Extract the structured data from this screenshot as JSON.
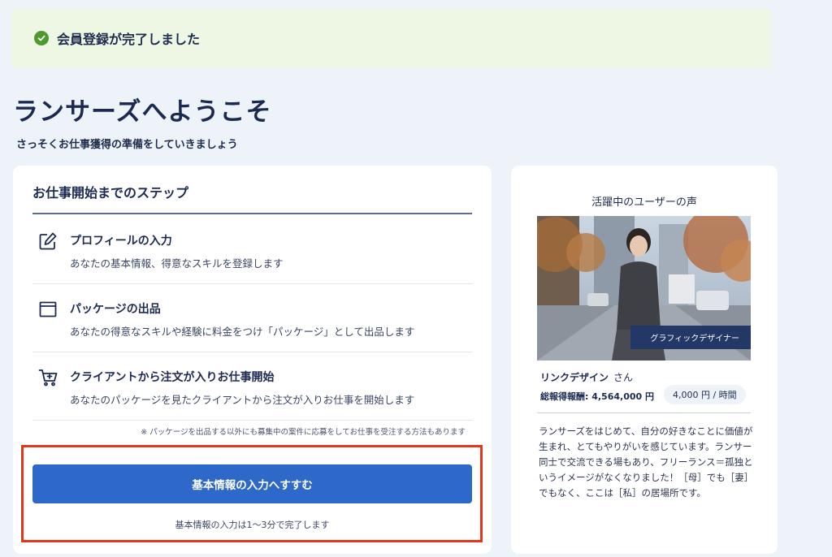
{
  "banner": {
    "icon": "check-circle-icon",
    "text": "会員登録が完了しました"
  },
  "page": {
    "title": "ランサーズへようこそ",
    "subtitle": "さっそくお仕事獲得の準備をしていきましょう"
  },
  "steps_card": {
    "title": "お仕事開始までのステップ",
    "steps": [
      {
        "icon": "edit-icon",
        "title": "プロフィールの入力",
        "desc": "あなたの基本情報、得意なスキルを登録します"
      },
      {
        "icon": "window-icon",
        "title": "パッケージの出品",
        "desc": "あなたの得意なスキルや経験に料金をつけ「パッケージ」として出品します"
      },
      {
        "icon": "cart-icon",
        "title": "クライアントから注文が入りお仕事開始",
        "desc": "あなたのパッケージを見たクライアントから注文が入りお仕事を開始します"
      }
    ],
    "note": "※ パッケージを出品する以外にも募集中の案件に応募をしてお仕事を受注する方法もあります",
    "cta_label": "基本情報の入力へすすむ",
    "cta_note": "基本情報の入力は1〜3分で完了します"
  },
  "testimonial": {
    "title": "活躍中のユーザーの声",
    "photo_tag": "グラフィックデザイナー",
    "user_name": "リンクデザイン",
    "honorific": "さん",
    "earnings": "総報得報酬: 4,564,000 円",
    "rate": "4,000 円 / 時間",
    "quote": "ランサーズをはじめて、自分の好きなことに価値が生まれ、とてもやりがいを感じています。ランサー同士で交流できる場もあり、フリーランス＝孤独というイメージがなくなりました！［母］でも［妻］でもなく、ここは［私］の居場所です。"
  },
  "colors": {
    "accent": "#2e69c9",
    "navy": "#1c2a52",
    "success": "#4e9a2f",
    "highlight": "#e0381d"
  }
}
